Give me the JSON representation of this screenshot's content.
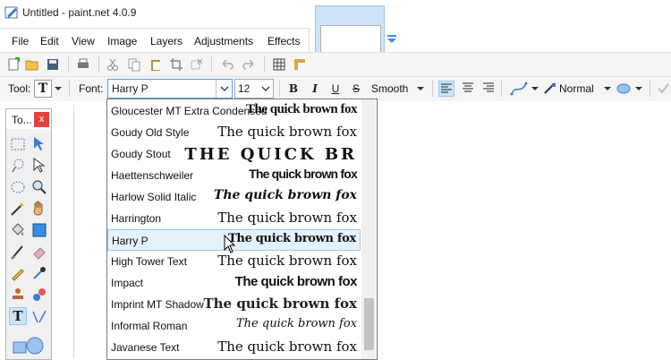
{
  "window": {
    "title": "Untitled - paint.net 4.0.9"
  },
  "menu": [
    "File",
    "Edit",
    "View",
    "Image",
    "Layers",
    "Adjustments",
    "Effects"
  ],
  "toolbar": {
    "tool_label": "Tool:",
    "font_label": "Font:",
    "font_value": "Harry P",
    "size_value": "12",
    "bold": "B",
    "italic": "I",
    "underline": "U",
    "strike": "S",
    "antialias": "Smooth",
    "blend_mode": "Normal"
  },
  "tools_window": {
    "title": "To...",
    "close": "x"
  },
  "font_list": {
    "sample_text": "The quick brown fox",
    "selected": "Harry P",
    "items": [
      {
        "name": "Gloucester MT Extra Condensed",
        "sample": "The quick brown fox"
      },
      {
        "name": "Goudy Old Style",
        "sample": "The quick brown fox"
      },
      {
        "name": "Goudy Stout",
        "sample": "THE QUICK BR"
      },
      {
        "name": "Haettenschweiler",
        "sample": "The quick brown fox"
      },
      {
        "name": "Harlow Solid Italic",
        "sample": "The quick brown fox"
      },
      {
        "name": "Harrington",
        "sample": "The quick brown fox"
      },
      {
        "name": "Harry P",
        "sample": "The quick brown fox"
      },
      {
        "name": "High Tower Text",
        "sample": "The quick brown fox"
      },
      {
        "name": "Impact",
        "sample": "The quick brown fox"
      },
      {
        "name": "Imprint MT Shadow",
        "sample": "The quick brown fox"
      },
      {
        "name": "Informal Roman",
        "sample": "The quick brown fox"
      },
      {
        "name": "Javanese Text",
        "sample": "The quick brown fox"
      }
    ]
  },
  "colors": {
    "accent": "#0078d7",
    "highlight": "#e5f1fb",
    "close_red": "#e04343"
  }
}
